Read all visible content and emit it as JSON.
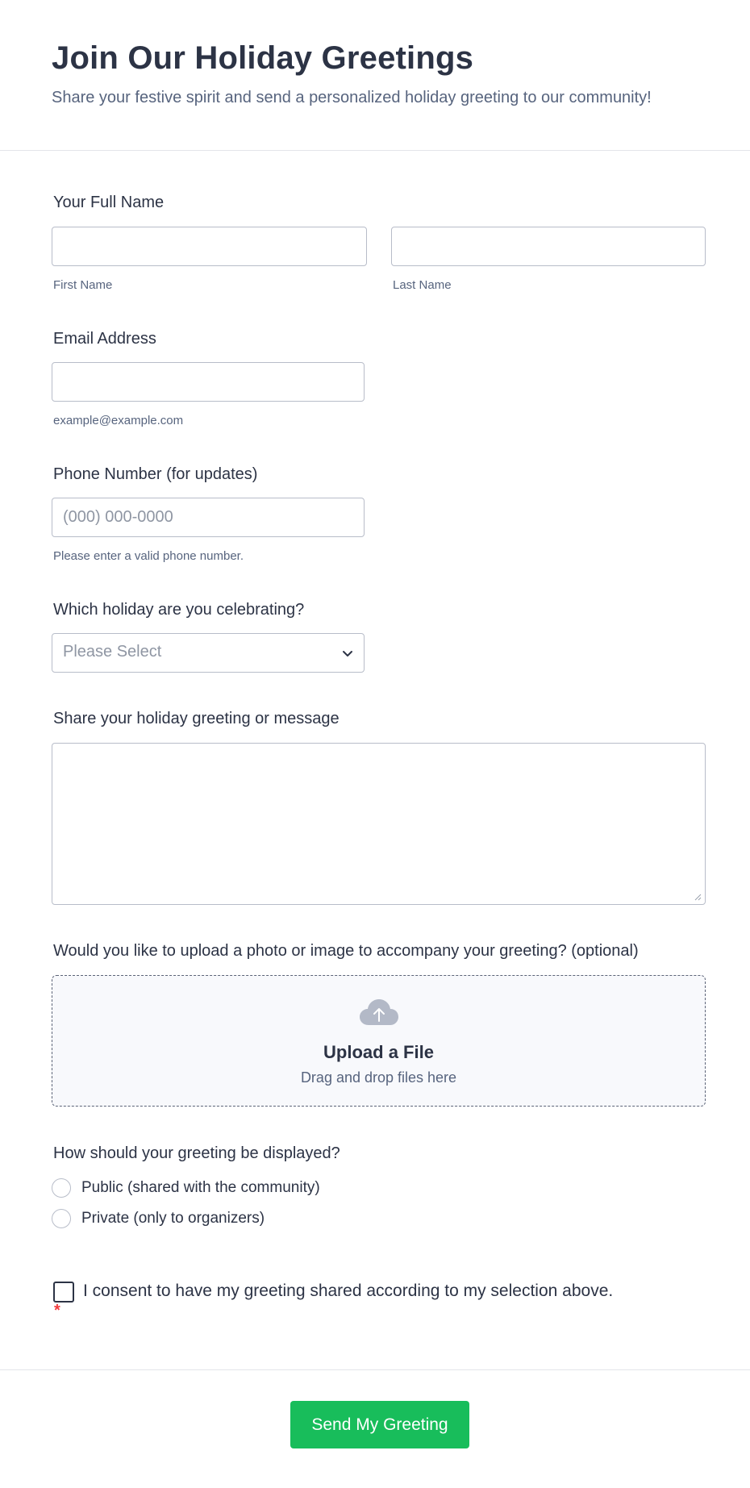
{
  "header": {
    "title": "Join Our Holiday Greetings",
    "subtitle": "Share your festive spirit and send a personalized holiday greeting to our community!"
  },
  "name_field": {
    "label": "Your Full Name",
    "first_sublabel": "First Name",
    "last_sublabel": "Last Name",
    "first_value": "",
    "last_value": ""
  },
  "email_field": {
    "label": "Email Address",
    "sublabel": "example@example.com",
    "value": ""
  },
  "phone_field": {
    "label": "Phone Number (for updates)",
    "placeholder": "(000) 000-0000",
    "sublabel": "Please enter a valid phone number.",
    "value": ""
  },
  "holiday_field": {
    "label": "Which holiday are you celebrating?",
    "selected": "Please Select",
    "icon": "chevron-down-icon"
  },
  "message_field": {
    "label": "Share your holiday greeting or message",
    "value": ""
  },
  "upload_field": {
    "label": "Would you like to upload a photo or image to accompany your greeting? (optional)",
    "title": "Upload a File",
    "hint": "Drag and drop files here",
    "icon": "cloud-upload-icon"
  },
  "display_field": {
    "label": "How should your greeting be displayed?",
    "options": [
      "Public (shared with the community)",
      "Private (only to organizers)"
    ]
  },
  "consent": {
    "label": "I consent to have my greeting shared according to my selection above.",
    "required_marker": "*",
    "checked": false
  },
  "submit": {
    "label": "Send My Greeting"
  },
  "colors": {
    "text": "#2c3345",
    "muted": "#57647e",
    "border": "#b8bdc9",
    "submit_bg": "#18bd5b",
    "required": "#f23a3c",
    "upload_bg": "#f8f9fc"
  }
}
